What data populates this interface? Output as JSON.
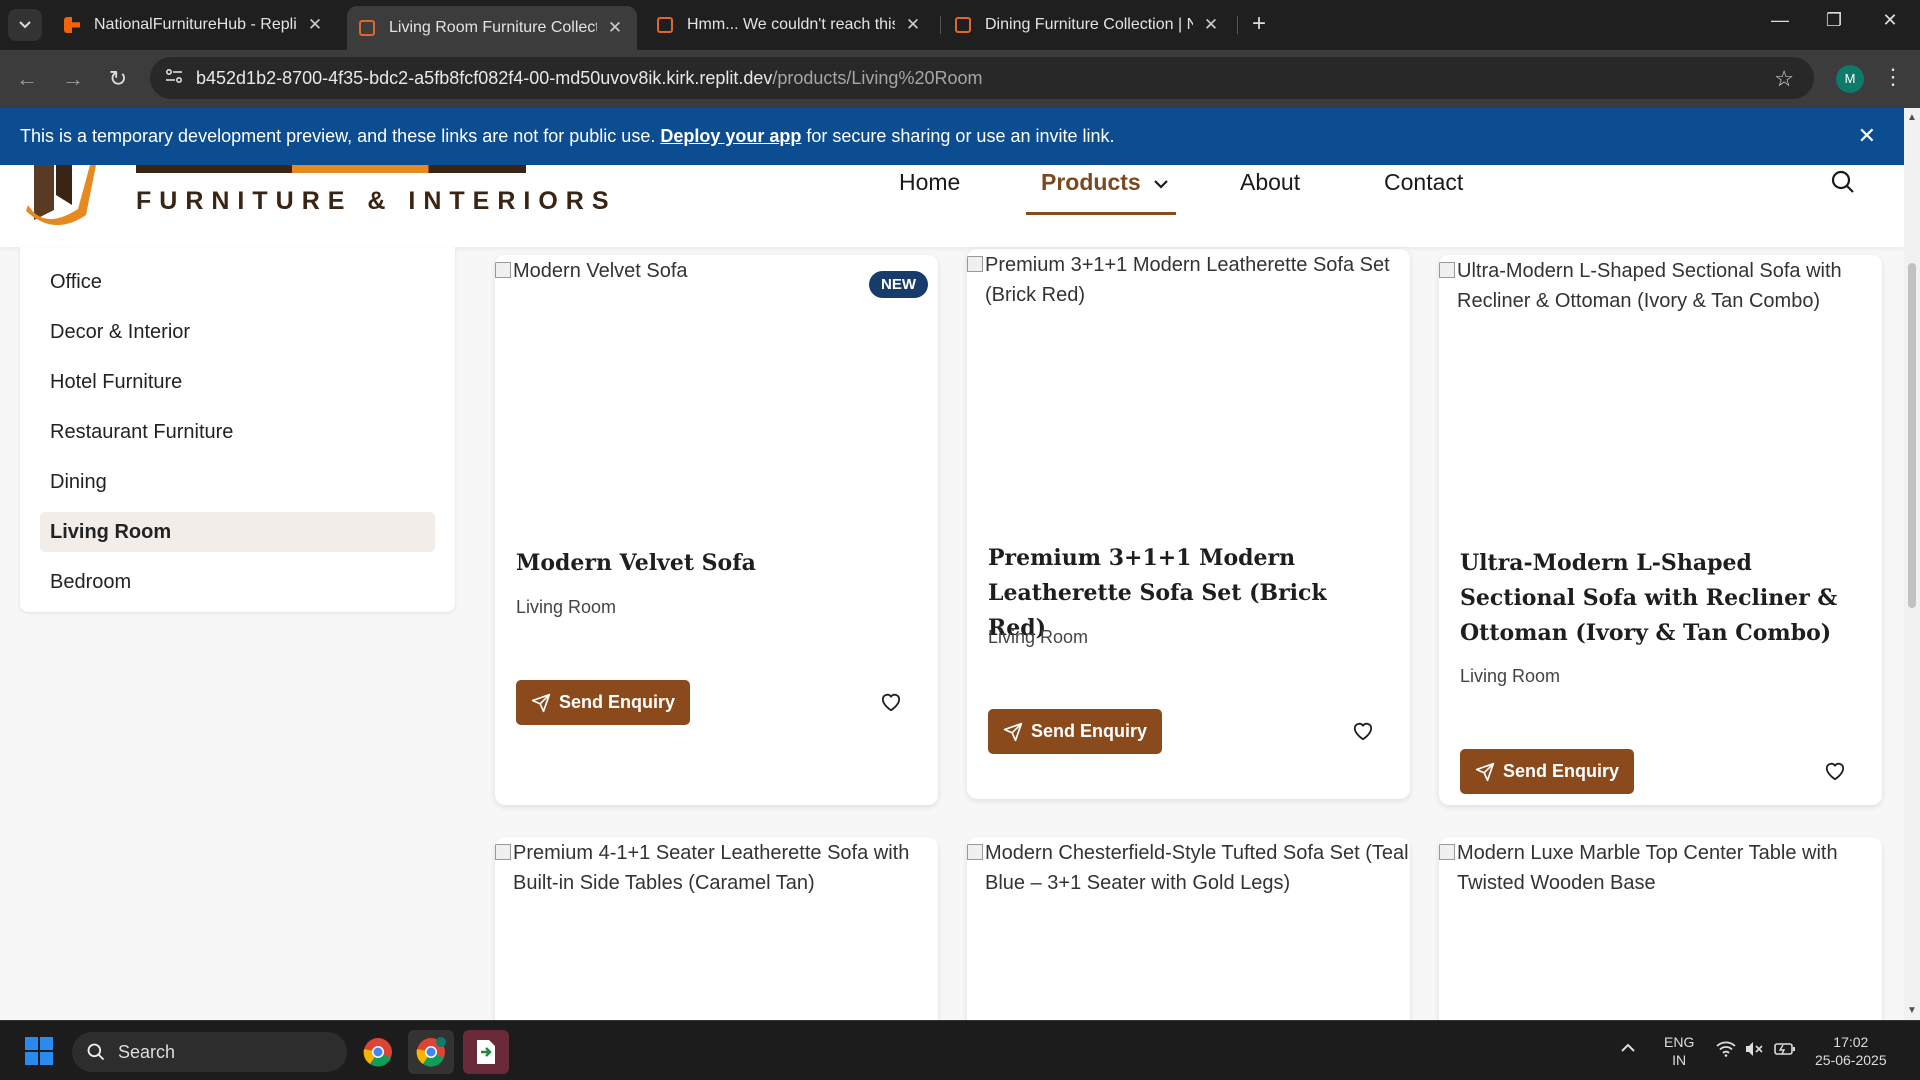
{
  "browser": {
    "tabs": [
      {
        "title": "NationalFurnitureHub - Replit",
        "favicon": "replit-icon",
        "active": false
      },
      {
        "title": "Living Room Furniture Collectio",
        "favicon": "sofa-icon",
        "active": true
      },
      {
        "title": "Hmm... We couldn't reach this a",
        "favicon": "sofa-icon",
        "active": false
      },
      {
        "title": "Dining Furniture Collection | Na",
        "favicon": "sofa-icon",
        "active": false
      }
    ],
    "url_host": "b452d1b2-8700-4f35-bdc2-a5fb8fcf082f4-00-md50uvov8ik.kirk.replit.dev",
    "url_path": "/products/Living%20Room",
    "profile_initial": "M"
  },
  "banner": {
    "text_before": "This is a temporary development preview, and these links are not for public use.",
    "link": "Deploy your app",
    "text_after": "for secure sharing or use an invite link."
  },
  "header": {
    "logo_tagline": "FURNITURE & INTERIORS",
    "nav": {
      "home": "Home",
      "products": "Products",
      "about": "About",
      "contact": "Contact"
    }
  },
  "sidebar": {
    "items": [
      {
        "label": "Office"
      },
      {
        "label": "Decor & Interior"
      },
      {
        "label": "Hotel Furniture"
      },
      {
        "label": "Restaurant Furniture"
      },
      {
        "label": "Dining"
      },
      {
        "label": "Living Room",
        "active": true
      },
      {
        "label": "Bedroom"
      }
    ]
  },
  "products": [
    {
      "image_alt": "Modern Velvet Sofa",
      "badge": "NEW",
      "title": "Modern Velvet Sofa",
      "category": "Living Room",
      "button": "Send Enquiry"
    },
    {
      "image_alt": "Premium 3+1+1 Modern Leatherette Sofa Set (Brick Red)",
      "title": "Premium 3+1+1 Modern Leatherette Sofa Set (Brick Red)",
      "category": "Living Room",
      "button": "Send Enquiry"
    },
    {
      "image_alt": "Ultra-Modern L-Shaped Sectional Sofa with Recliner & Ottoman (Ivory & Tan Combo)",
      "title": "Ultra-Modern L-Shaped Sectional Sofa with Recliner & Ottoman (Ivory & Tan Combo)",
      "category": "Living Room",
      "button": "Send Enquiry"
    },
    {
      "image_alt": "Premium 4-1+1 Seater Leatherette Sofa with Built-in Side Tables (Caramel Tan)"
    },
    {
      "image_alt": "Modern Chesterfield-Style Tufted Sofa Set (Teal Blue – 3+1 Seater with Gold Legs)"
    },
    {
      "image_alt": "Modern Luxe Marble Top Center Table with Twisted Wooden Base"
    }
  ],
  "taskbar": {
    "search_placeholder": "Search",
    "lang_top": "ENG",
    "lang_bottom": "IN",
    "time": "17:02",
    "date": "25-06-2025"
  },
  "colors": {
    "brand_brown": "#8b4a1c",
    "banner_blue": "#0c4d91",
    "badge_navy": "#173c6b",
    "logo_orange": "#e58a1f"
  }
}
